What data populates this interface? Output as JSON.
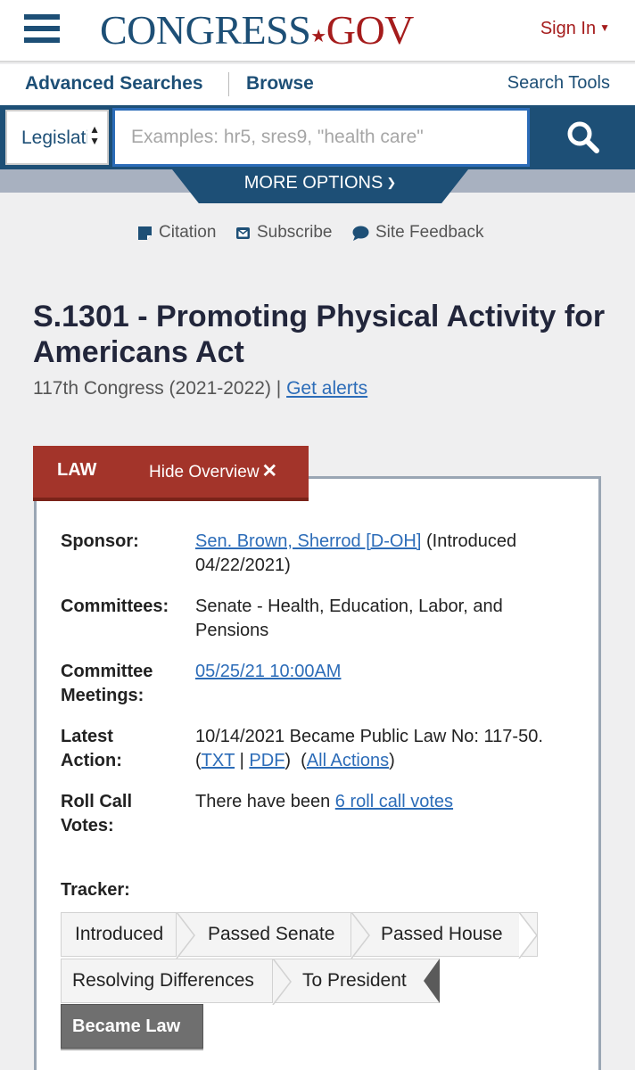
{
  "header": {
    "logo_part1": "CONGRESS",
    "logo_dot": "★",
    "logo_part2": "GOV",
    "sign_in": "Sign In",
    "sign_in_caret": "▼"
  },
  "nav": {
    "advanced_searches": "Advanced Searches",
    "browse": "Browse",
    "search_tools": "Search Tools"
  },
  "search": {
    "scope_value": "Legislation",
    "placeholder": "Examples: hr5, sres9, \"health care\"",
    "value": ""
  },
  "more_options": "MORE OPTIONS",
  "utility_links": {
    "citation": "Citation",
    "subscribe": "Subscribe",
    "site_feedback": "Site Feedback"
  },
  "bill": {
    "title": "S.1301 - Promoting Physical Activity for Americans Act",
    "congress": "117th Congress (2021-2022) |",
    "get_alerts": "Get alerts"
  },
  "overview": {
    "status_tab": "LAW",
    "hide_overview": "Hide Overview",
    "hide_icon": "✕",
    "sponsor_label": "Sponsor:",
    "sponsor_link": "Sen. Brown, Sherrod [D-OH]",
    "sponsor_intro": " (Introduced 04/22/2021)",
    "committees_label": "Committees:",
    "committees_value": "Senate - Health, Education, Labor, and Pensions",
    "meetings_label_1": "Committee",
    "meetings_label_2": "Meetings:",
    "meetings_link": "05/25/21 10:00AM",
    "latest_label_1": "Latest",
    "latest_label_2": "Action:",
    "latest_text": "10/14/2021 Became Public Law No: 117-50. (",
    "latest_txt": "TXT",
    "latest_sep": " | ",
    "latest_pdf": "PDF",
    "latest_mid": ")  (",
    "latest_all": "All Actions",
    "latest_end": ")",
    "rollcall_label_1": "Roll Call",
    "rollcall_label_2": "Votes:",
    "rollcall_text": "There have been ",
    "rollcall_link": "6 roll call votes"
  },
  "tracker": {
    "label": "Tracker:",
    "steps": [
      "Introduced",
      "Passed Senate",
      "Passed House",
      "Resolving Differences",
      "To President",
      "Became Law"
    ],
    "current_step": "Became Law"
  },
  "colors": {
    "brand_blue": "#1d4f76",
    "brand_red": "#a51c1c",
    "link_blue": "#2c6cb8",
    "law_tab": "#a3342a"
  }
}
